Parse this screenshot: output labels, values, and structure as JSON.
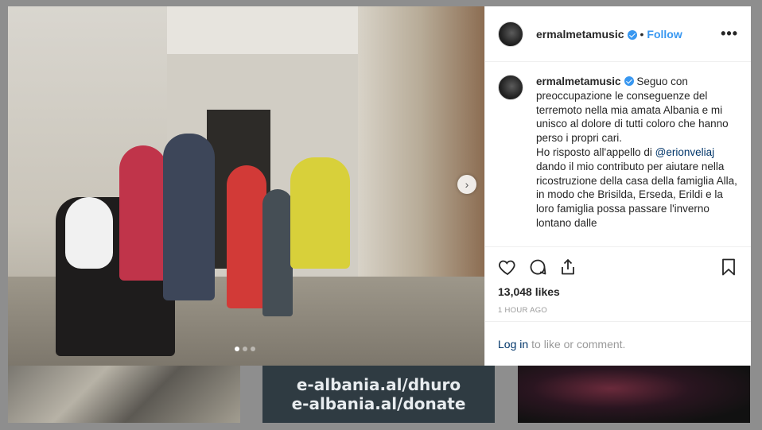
{
  "post": {
    "username": "ermalmetamusic",
    "follow_label": "Follow",
    "separator": "•",
    "more_label": "•••",
    "caption_parts": {
      "p1": "Seguo con preoccupazione le conseguenze del terremoto nella mia amata Albania e mi unisco al dolore di tutti coloro che hanno perso i propri cari.",
      "p2_before": "Ho risposto all'appello di ",
      "mention": "@erionveliaj",
      "p2_after": " dando il mio contributo per aiutare nella ricostruzione della casa della famiglia Alla, in modo che Brisilda, Erseda, Erildi e la loro famiglia possa passare l'inverno lontano dalle"
    },
    "likes": "13,048 likes",
    "time_ago": "1 HOUR AGO",
    "login_link": "Log in",
    "login_rest": "to like or comment."
  },
  "carousel": {
    "next_icon": "chevron-right-icon",
    "slides": 3,
    "active": 1
  },
  "background": {
    "thumb2_line1": "e-albania.al/dhuro",
    "thumb2_line2": "e-albania.al/donate"
  },
  "colors": {
    "link": "#3897f0",
    "mention": "#003569",
    "text": "#262626",
    "muted": "#999999"
  }
}
